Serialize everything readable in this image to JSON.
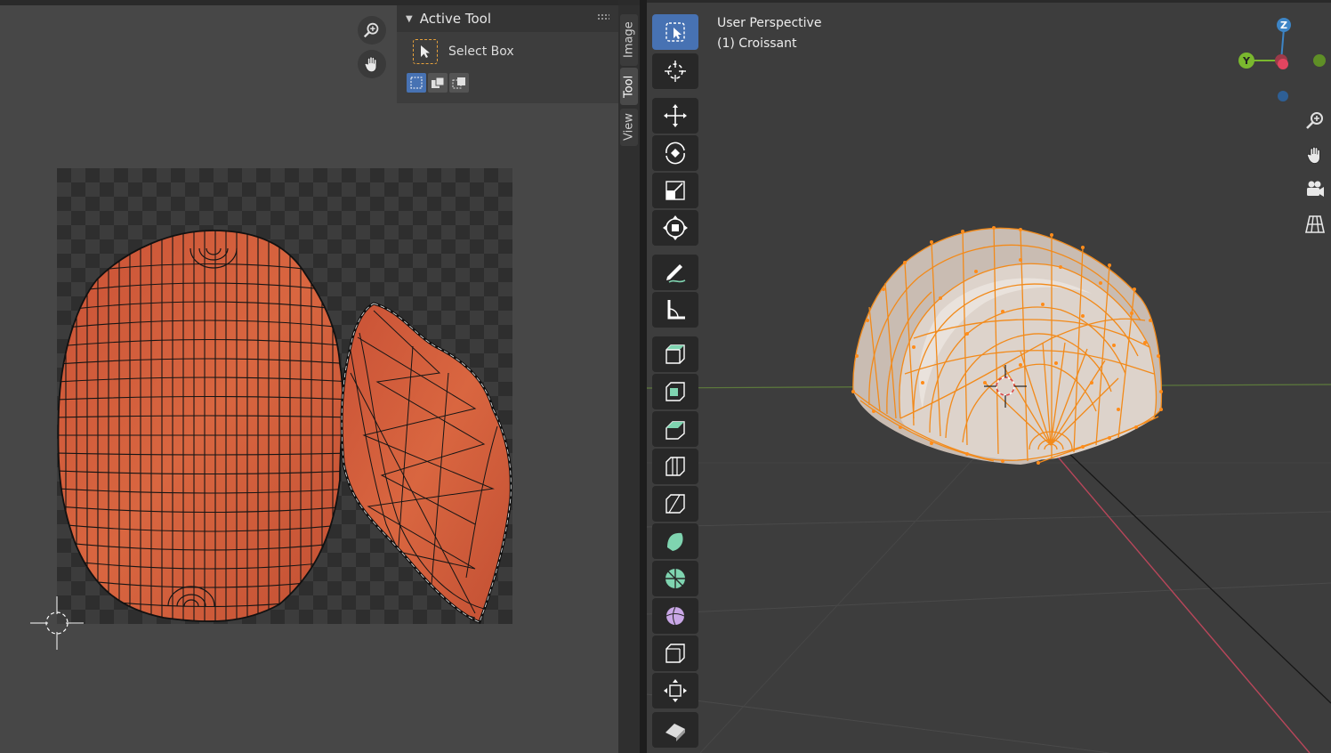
{
  "uv_editor": {
    "active_tool_panel": {
      "title": "Active Tool",
      "tool_name": "Select Box"
    },
    "side_tabs": [
      "Image",
      "Tool",
      "View"
    ],
    "active_side_tab": "Tool"
  },
  "viewport": {
    "view_label": "User Perspective",
    "object_label": "(1) Croissant",
    "gizmo_axes": {
      "z": "Z",
      "y": "Y"
    },
    "toolbar_tools": [
      "select-box",
      "cursor",
      "move",
      "rotate",
      "scale",
      "transform",
      "annotate",
      "measure",
      "add-cube",
      "extrude-region",
      "inset-faces",
      "bevel",
      "loop-cut",
      "knife",
      "poly-build",
      "spin",
      "smooth",
      "edge-slide",
      "shrink-fatten",
      "shear"
    ]
  },
  "colors": {
    "accent_blue": "#4772b3",
    "uv_island": "#d25a3a",
    "selection_orange": "#f08c1e",
    "axis_x": "#d4405a",
    "axis_y": "#7ab82e",
    "axis_z": "#3d85c6"
  }
}
